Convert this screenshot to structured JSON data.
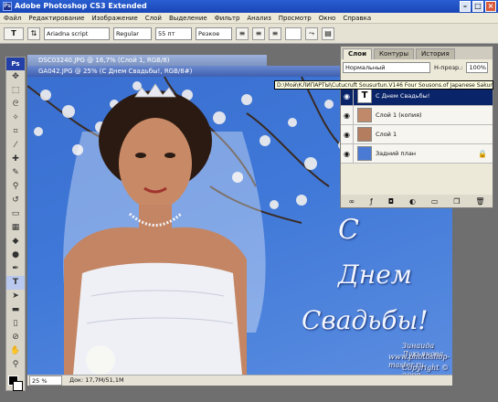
{
  "app": {
    "title": "Adobe Photoshop CS3 Extended",
    "logo": "Ps"
  },
  "menu": [
    "Файл",
    "Редактирование",
    "Изображение",
    "Слой",
    "Выделение",
    "Фильтр",
    "Анализ",
    "Просмотр",
    "Окно",
    "Справка"
  ],
  "options": {
    "tool_glyph": "T",
    "font_family": "Ariadna script",
    "font_style": "Regular",
    "font_size": "55 пт",
    "anti_alias": "Резкое"
  },
  "documents": {
    "back": "DSC03240.JPG @ 16,7% (Слой 1, RGB/8)",
    "front": "GA042.JPG @ 25% (С Днем Свадьбы!, RGB/8#)"
  },
  "tooltip": "D:\\Мой\\КЛИПАРТЫ\\Cutucruft Sousurtun.V146 Four Sousons.of Japanese Sakura",
  "canvas": {
    "greeting_lines": [
      "С",
      "Днем",
      "Свадьбы!"
    ],
    "credit_lines": [
      "Зинаида Лукьянова",
      "www.photoshop-master.ru",
      "Copyright © 2008"
    ]
  },
  "status": {
    "zoom": "25 %",
    "doc": "Док: 17,7M/51,1M"
  },
  "layers_panel": {
    "tabs": [
      "Слои",
      "Контуры",
      "История"
    ],
    "blend_mode": "Нормальный",
    "opacity_label": "Н-прозр.:",
    "opacity_value": "100%",
    "layers": [
      {
        "name": "С Днем Свадьбы!",
        "kind": "text",
        "selected": true
      },
      {
        "name": "Слой 1 (копия)",
        "kind": "image",
        "selected": false
      },
      {
        "name": "Слой 1",
        "kind": "image",
        "selected": false
      },
      {
        "name": "Задний план",
        "kind": "background",
        "selected": false,
        "locked": true
      }
    ],
    "footer_icons": [
      "link-icon",
      "fx-icon",
      "mask-icon",
      "adjustment-icon",
      "folder-icon",
      "new-layer-icon",
      "trash-icon"
    ]
  },
  "colors": {
    "sky": "#3f78d8",
    "selected_layer": "#0a246a",
    "titlebar": "#2a5fd1"
  }
}
